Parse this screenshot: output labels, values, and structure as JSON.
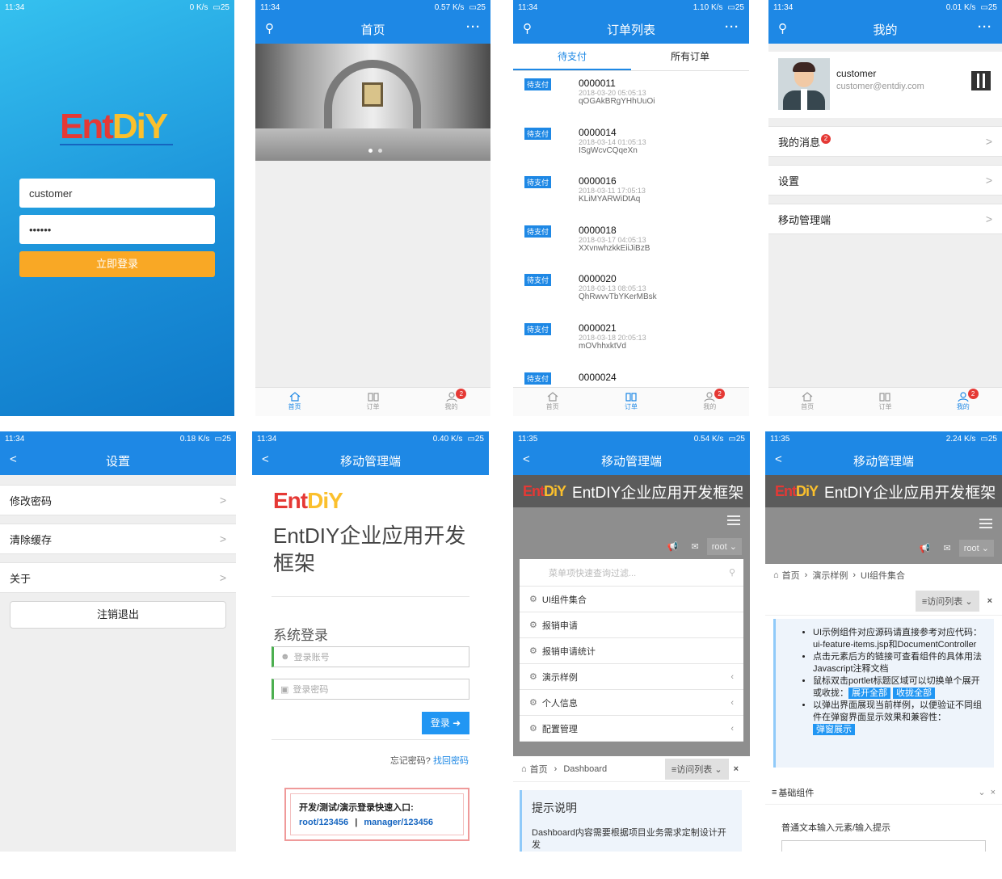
{
  "status": {
    "p1": {
      "time": "11:34",
      "speed": "0 K/s",
      "batt": "25"
    },
    "p2": {
      "time": "11:34",
      "speed": "0.57 K/s",
      "batt": "25"
    },
    "p3": {
      "time": "11:34",
      "speed": "1.10 K/s",
      "batt": "25"
    },
    "p4": {
      "time": "11:34",
      "speed": "0.01 K/s",
      "batt": "25"
    },
    "p5": {
      "time": "11:34",
      "speed": "0.18 K/s",
      "batt": "25"
    },
    "p6": {
      "time": "11:34",
      "speed": "0.40 K/s",
      "batt": "25"
    },
    "p7": {
      "time": "11:35",
      "speed": "0.54 K/s",
      "batt": "25"
    },
    "p8": {
      "time": "11:35",
      "speed": "2.24 K/s",
      "batt": "25"
    }
  },
  "login": {
    "logo_ent": "Ent",
    "logo_diy": "DiY",
    "username": "customer",
    "password": "••••••",
    "button": "立即登录"
  },
  "home": {
    "title": "首页"
  },
  "tabs": {
    "home": "首页",
    "orders": "订单",
    "mine": "我的",
    "badge": "2"
  },
  "orders": {
    "title": "订单列表",
    "tab_pending": "待支付",
    "tab_all": "所有订单",
    "items": [
      {
        "status": "待支付",
        "no": "0000011",
        "date": "2018-03-20 05:05:13",
        "code": "qOGAkBRgYHhUuOi"
      },
      {
        "status": "待支付",
        "no": "0000014",
        "date": "2018-03-14 01:05:13",
        "code": "ISgWcvCQqeXn"
      },
      {
        "status": "待支付",
        "no": "0000016",
        "date": "2018-03-11 17:05:13",
        "code": "KLiMYARWiDtAq"
      },
      {
        "status": "待支付",
        "no": "0000018",
        "date": "2018-03-17 04:05:13",
        "code": "XXvnwhzkkEiiJiBzB"
      },
      {
        "status": "待支付",
        "no": "0000020",
        "date": "2018-03-13 08:05:13",
        "code": "QhRwvvTbYKerMBsk"
      },
      {
        "status": "待支付",
        "no": "0000021",
        "date": "2018-03-18 20:05:13",
        "code": "mOVhhxktVd"
      },
      {
        "status": "待支付",
        "no": "0000024",
        "date": "",
        "code": ""
      }
    ]
  },
  "mine": {
    "title": "我的",
    "name": "customer",
    "email": "customer@entdiy.com",
    "messages": "我的消息",
    "msg_badge": "2",
    "settings": "设置",
    "mobile_admin": "移动管理端"
  },
  "settings": {
    "title": "设置",
    "change_pwd": "修改密码",
    "clear_cache": "清除缓存",
    "about": "关于",
    "logout": "注销退出"
  },
  "admin_login": {
    "title": "移动管理端",
    "heading": "EntDIY企业应用开发框架",
    "section": "系统登录",
    "account_ph": "登录账号",
    "password_ph": "登录密码",
    "login_btn": "登录",
    "forgot": "忘记密码?",
    "find_pwd": "找回密码",
    "quick_label": "开发/测试/演示登录快速入口:",
    "acc1": "root/123456",
    "sep": "|",
    "acc2": "manager/123456"
  },
  "admin_menu": {
    "title": "移动管理端",
    "banner": "EntDIY企业应用开发框架",
    "user": "root",
    "search_ph": "菜单项快速查询过滤...",
    "items": [
      "UI组件集合",
      "报销申请",
      "报销申请统计",
      "演示样例",
      "个人信息",
      "配置管理"
    ],
    "breadcrumb_home": "首页",
    "breadcrumb_page": "Dashboard",
    "visit_list": "访问列表",
    "tip_title": "提示说明",
    "tip_text": "Dashboard内容需要根据项目业务需求定制设计开发"
  },
  "admin_ui": {
    "title": "移动管理端",
    "banner": "EntDIY企业应用开发框架",
    "user": "root",
    "crumb1": "首页",
    "crumb2": "演示样例",
    "crumb3": "UI组件集合",
    "visit_list": "访问列表",
    "bullet1": "UI示例组件对应源码请直接参考对应代码：ui-feature-items.jsp和DocumentController",
    "bullet2": "点击元素后方的链接可查看组件的具体用法Javascript注释文档",
    "bullet3": "鼠标双击portlet标题区域可以切换单个展开或收拢：",
    "expand_all": "展开全部",
    "collapse_all": "收拢全部",
    "bullet4": "以弹出界面展现当前样例，以便验证不同组件在弹窗界面显示效果和兼容性：",
    "popup": "弹窗展示",
    "section": "基础组件",
    "field_label": "普通文本输入元素/输入提示"
  }
}
